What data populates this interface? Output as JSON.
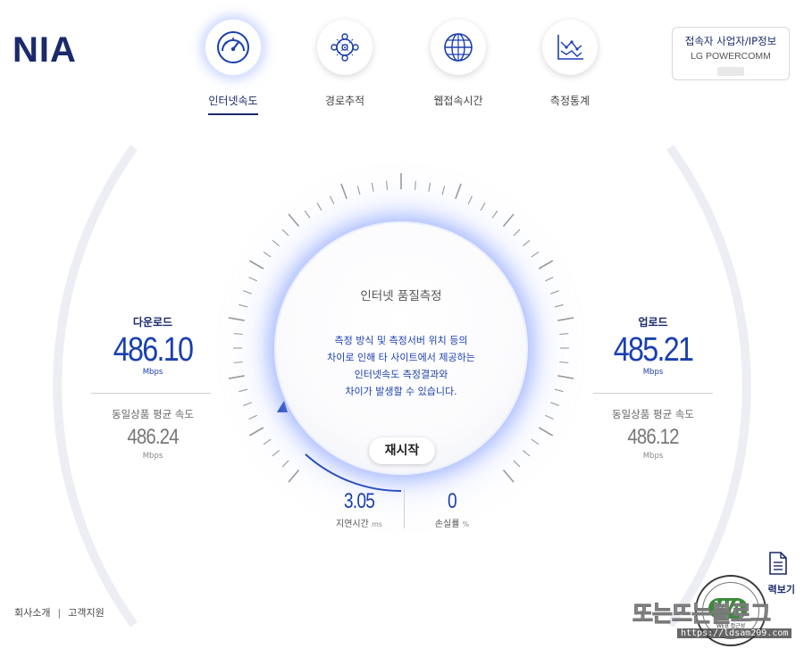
{
  "brand": {
    "logo": "NIA"
  },
  "nav": [
    {
      "label": "인터넷속도",
      "icon": "speedometer-icon",
      "active": true
    },
    {
      "label": "경로추적",
      "icon": "route-network-icon",
      "active": false
    },
    {
      "label": "웹접속시간",
      "icon": "globe-icon",
      "active": false
    },
    {
      "label": "측정통계",
      "icon": "statistics-chart-icon",
      "active": false
    }
  ],
  "ip_info": {
    "title": "접속자 사업자/IP정보",
    "isp": "LG POWERCOMM"
  },
  "download": {
    "title": "다운로드",
    "value": "486.10",
    "unit": "Mbps",
    "avg_label": "동일상품 평균 속도",
    "avg_value": "486.24",
    "avg_unit": "Mbps"
  },
  "upload": {
    "title": "업로드",
    "value": "485.21",
    "unit": "Mbps",
    "avg_label": "동일상품 평균 속도",
    "avg_value": "486.12",
    "avg_unit": "Mbps"
  },
  "center": {
    "title": "인터넷 품질측정",
    "desc": [
      "측정 방식 및 측정서버 위치 등의",
      "차이로 인해 타 사이트에서 제공하는",
      "인터넷속도 측정결과와",
      "차이가 발생할 수 있습니다."
    ],
    "restart": "재시작"
  },
  "latency": {
    "value": "3.05",
    "label": "지연시간",
    "unit": "ms"
  },
  "loss": {
    "value": "0",
    "label": "손실률",
    "unit": "%"
  },
  "footer": {
    "company": "회사소개",
    "separator": "|",
    "support": "고객지원"
  },
  "history": {
    "label": "력보기",
    "icon": "document-icon"
  },
  "seal": {
    "text": "WA",
    "caption": "WEB 접근성"
  },
  "watermark": {
    "text": "또는뜨는블로그",
    "url": "https://ldsam209.com"
  },
  "colors": {
    "primary": "#1a2a6c",
    "accent": "#1a3fb0",
    "glow": "#6e8cff"
  }
}
